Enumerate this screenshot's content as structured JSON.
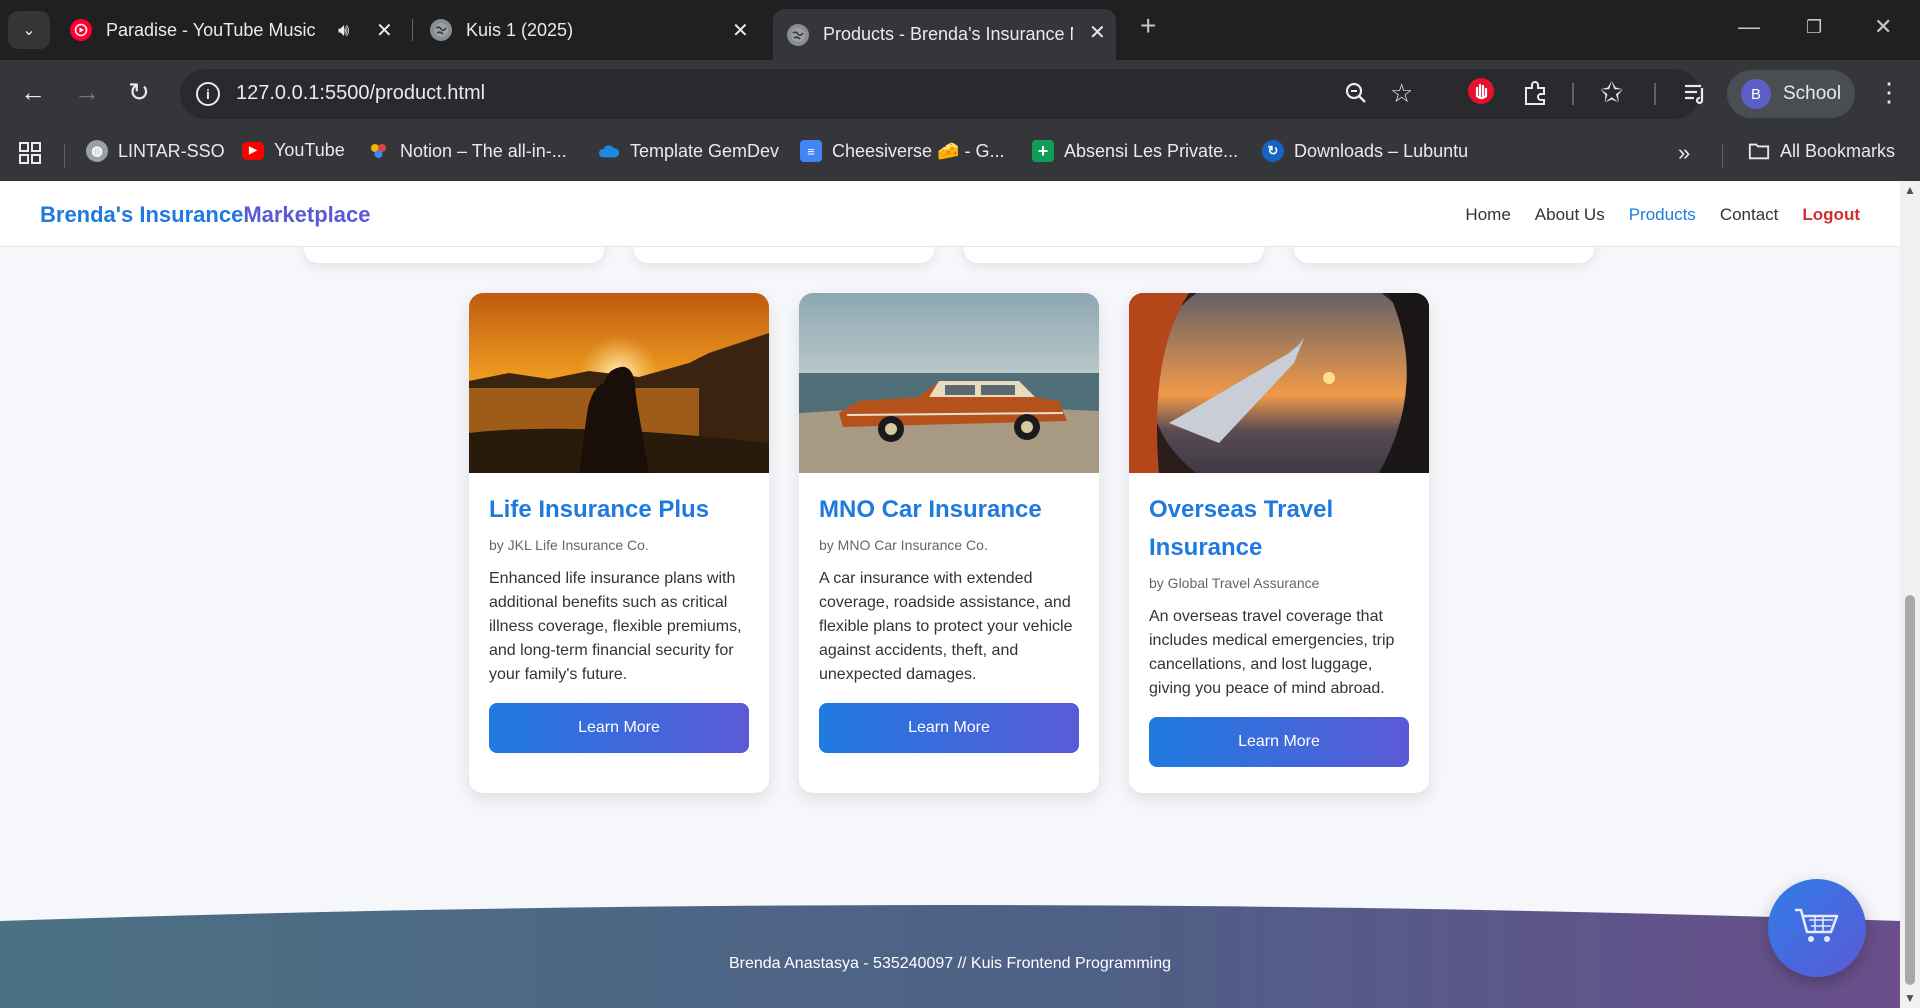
{
  "browser": {
    "tabs": [
      {
        "title": "Paradise - YouTube Music",
        "active": false
      },
      {
        "title": "Kuis 1 (2025)",
        "active": false
      },
      {
        "title": "Products - Brenda's Insurance M",
        "active": true
      }
    ],
    "url": "127.0.0.1:5500/product.html",
    "profile_initial": "B",
    "profile_name": "School",
    "bookmarks": [
      {
        "label": "LINTAR-SSO",
        "icon": "globe-icon"
      },
      {
        "label": "YouTube",
        "icon": "youtube-icon"
      },
      {
        "label": "Notion – The all-in-...",
        "icon": "notion-icon"
      },
      {
        "label": "Template GemDev",
        "icon": "onedrive-icon"
      },
      {
        "label": "Cheesiverse 🧀 - G...",
        "icon": "docs-icon"
      },
      {
        "label": "Absensi Les Private...",
        "icon": "sheets-icon"
      },
      {
        "label": "Downloads – Lubuntu",
        "icon": "lubuntu-icon"
      }
    ],
    "all_bookmarks": "All Bookmarks"
  },
  "site": {
    "brand_part1": "Brenda's Insurance",
    "brand_part2": "Marketplace",
    "nav": {
      "home": "Home",
      "about": "About Us",
      "products": "Products",
      "contact": "Contact",
      "logout": "Logout"
    },
    "products": [
      {
        "title": "Life Insurance Plus",
        "company": "by JKL Life Insurance Co.",
        "description": "Enhanced life insurance plans with additional benefits such as critical illness coverage, flexible premiums, and long-term financial security for your family's future.",
        "button": "Learn More"
      },
      {
        "title": "MNO Car Insurance",
        "company": "by MNO Car Insurance Co.",
        "description": "A car insurance with extended coverage, roadside assistance, and flexible plans to protect your vehicle against accidents, theft, and unexpected damages.",
        "button": "Learn More"
      },
      {
        "title": "Overseas Travel Insurance",
        "company": "by Global Travel Assurance",
        "description": "An overseas travel coverage that includes medical emergencies, trip cancellations, and lost luggage, giving you peace of mind abroad.",
        "button": "Learn More"
      }
    ],
    "footer": "Brenda Anastasya - 535240097 // Kuis Frontend Programming"
  },
  "colors": {
    "brand_blue": "#1f7ae0",
    "brand_purple": "#5b5ad6",
    "logout_red": "#d32f2f"
  }
}
